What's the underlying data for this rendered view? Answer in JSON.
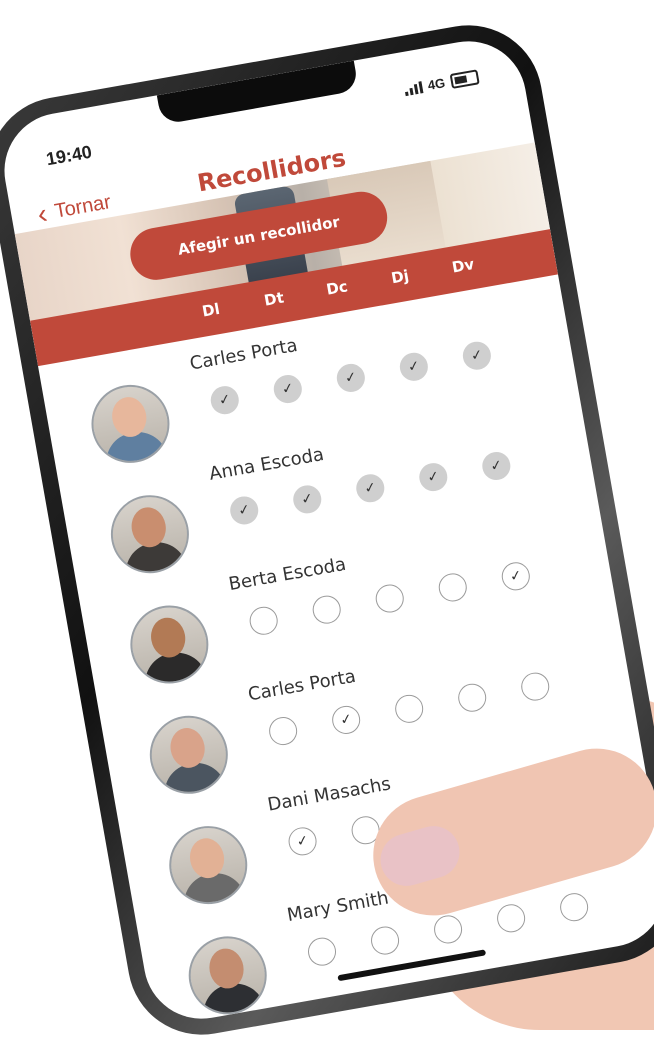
{
  "status": {
    "time": "19:40",
    "network": "4G"
  },
  "nav": {
    "back_label": "Tornar",
    "title": "Recollidors"
  },
  "actions": {
    "add_label": "Afegir un recollidor"
  },
  "days": [
    "Dl",
    "Dt",
    "Dc",
    "Dj",
    "Dv"
  ],
  "collectors": [
    {
      "name": "Carles Porta",
      "days": [
        true,
        true,
        true,
        true,
        true
      ],
      "style": "filled"
    },
    {
      "name": "Anna Escoda",
      "days": [
        true,
        true,
        true,
        true,
        true
      ],
      "style": "filled"
    },
    {
      "name": "Berta Escoda",
      "days": [
        false,
        false,
        false,
        false,
        true
      ],
      "style": "outline"
    },
    {
      "name": "Carles Porta",
      "days": [
        false,
        true,
        false,
        false,
        false
      ],
      "style": "outline"
    },
    {
      "name": "Dani Masachs",
      "days": [
        true,
        false,
        false,
        true,
        true
      ],
      "style": "outline"
    },
    {
      "name": "Mary Smith",
      "days": [
        false,
        false,
        false,
        false,
        false
      ],
      "style": "outline"
    }
  ],
  "colors": {
    "accent": "#c0493a",
    "check_fill": "#cfcfcf"
  }
}
